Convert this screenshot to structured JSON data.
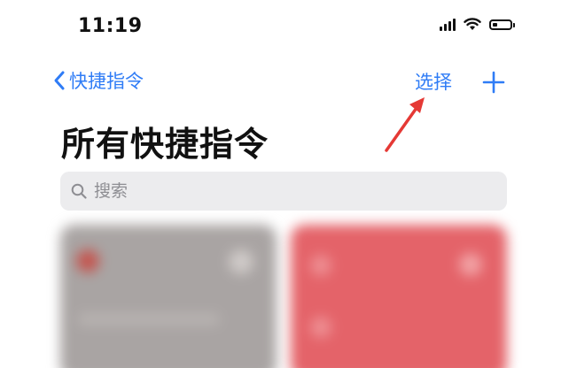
{
  "status_bar": {
    "time": "11:19",
    "battery_level": 0.25,
    "icons": [
      "cellular-signal-icon",
      "wifi-icon",
      "battery-icon"
    ]
  },
  "nav": {
    "back_label": "快捷指令",
    "select_label": "选择",
    "add_icon": "plus-icon"
  },
  "page": {
    "title": "所有快捷指令"
  },
  "search": {
    "placeholder": "搜索"
  },
  "cards": [
    {
      "color": "#a9a4a3"
    },
    {
      "color": "#e46369"
    }
  ],
  "colors": {
    "accent": "#2f7cf6",
    "annotation_arrow": "#e53935"
  }
}
